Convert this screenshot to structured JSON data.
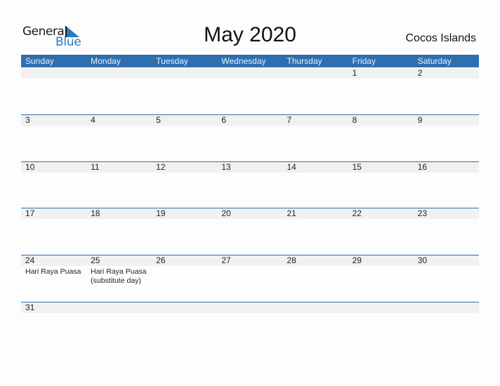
{
  "logo": {
    "general": "General",
    "blue": "Blue",
    "icon": "triangle-flag-icon",
    "brand_color": "#2b78c2"
  },
  "title": "May 2020",
  "country": "Cocos Islands",
  "header_color": "#2e6fb0",
  "weekdays": [
    "Sunday",
    "Monday",
    "Tuesday",
    "Wednesday",
    "Thursday",
    "Friday",
    "Saturday"
  ],
  "weeks": [
    {
      "days": [
        {
          "num": "",
          "events": []
        },
        {
          "num": "",
          "events": []
        },
        {
          "num": "",
          "events": []
        },
        {
          "num": "",
          "events": []
        },
        {
          "num": "",
          "events": []
        },
        {
          "num": "1",
          "events": []
        },
        {
          "num": "2",
          "events": []
        }
      ]
    },
    {
      "days": [
        {
          "num": "3",
          "events": []
        },
        {
          "num": "4",
          "events": []
        },
        {
          "num": "5",
          "events": []
        },
        {
          "num": "6",
          "events": []
        },
        {
          "num": "7",
          "events": []
        },
        {
          "num": "8",
          "events": []
        },
        {
          "num": "9",
          "events": []
        }
      ]
    },
    {
      "days": [
        {
          "num": "10",
          "events": []
        },
        {
          "num": "11",
          "events": []
        },
        {
          "num": "12",
          "events": []
        },
        {
          "num": "13",
          "events": []
        },
        {
          "num": "14",
          "events": []
        },
        {
          "num": "15",
          "events": []
        },
        {
          "num": "16",
          "events": []
        }
      ]
    },
    {
      "days": [
        {
          "num": "17",
          "events": []
        },
        {
          "num": "18",
          "events": []
        },
        {
          "num": "19",
          "events": []
        },
        {
          "num": "20",
          "events": []
        },
        {
          "num": "21",
          "events": []
        },
        {
          "num": "22",
          "events": []
        },
        {
          "num": "23",
          "events": []
        }
      ]
    },
    {
      "days": [
        {
          "num": "24",
          "events": [
            "Hari Raya Puasa"
          ]
        },
        {
          "num": "25",
          "events": [
            "Hari Raya Puasa",
            "(substitute day)"
          ]
        },
        {
          "num": "26",
          "events": []
        },
        {
          "num": "27",
          "events": []
        },
        {
          "num": "28",
          "events": []
        },
        {
          "num": "29",
          "events": []
        },
        {
          "num": "30",
          "events": []
        }
      ]
    },
    {
      "days": [
        {
          "num": "31",
          "events": []
        },
        {
          "num": "",
          "events": []
        },
        {
          "num": "",
          "events": []
        },
        {
          "num": "",
          "events": []
        },
        {
          "num": "",
          "events": []
        },
        {
          "num": "",
          "events": []
        },
        {
          "num": "",
          "events": []
        }
      ]
    }
  ]
}
